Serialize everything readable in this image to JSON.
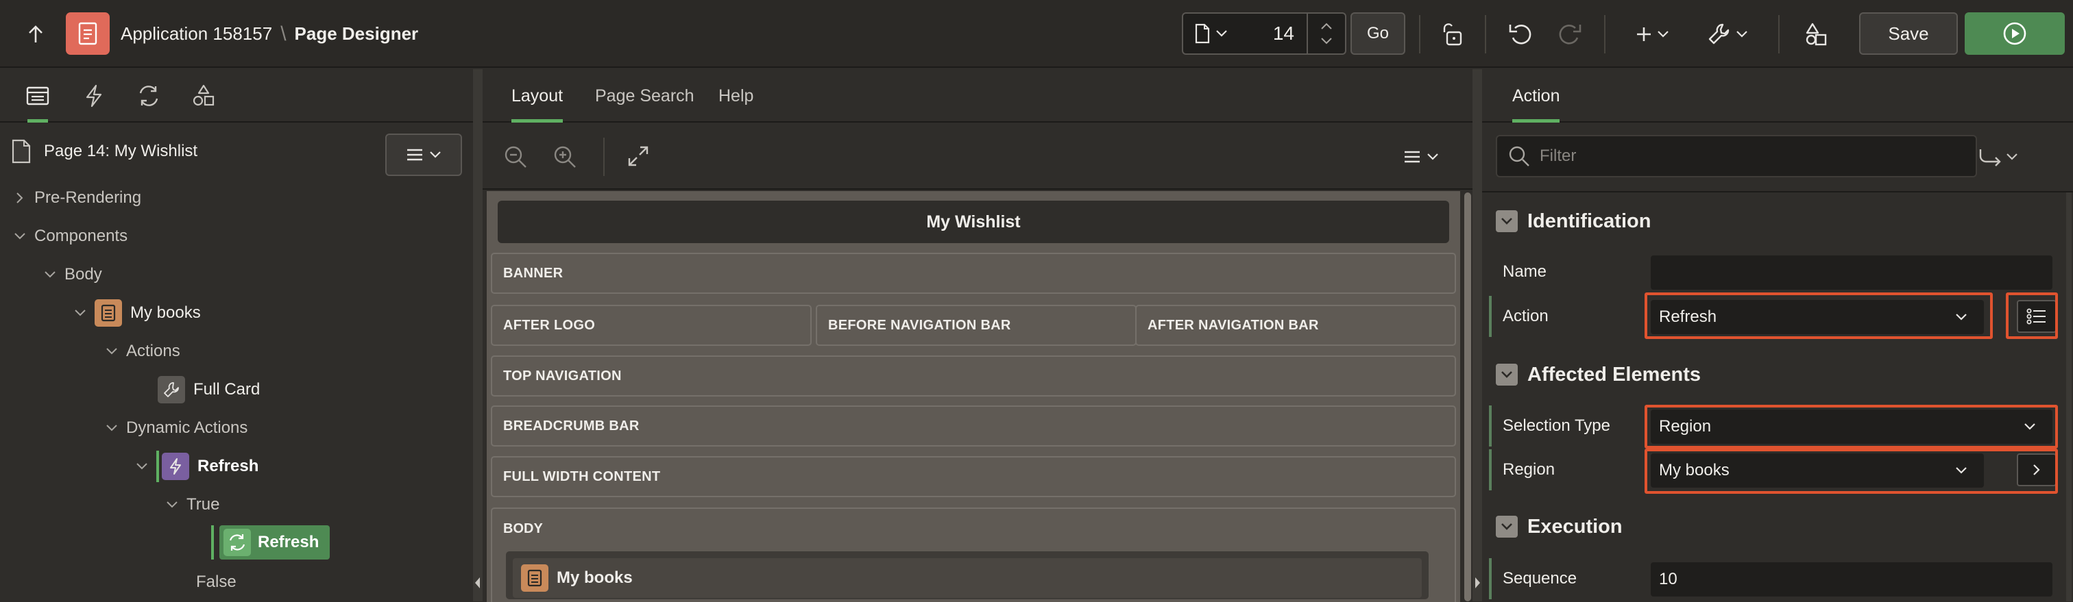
{
  "header": {
    "app_name": "Application 158157",
    "separator": "\\",
    "page_title": "Page Designer",
    "page_number": "14",
    "go_label": "Go",
    "save_label": "Save"
  },
  "left_panel": {
    "tabs": [
      "rendering-tab",
      "dynamic-actions-tab",
      "processing-tab",
      "shared-components-tab"
    ],
    "page_label": "Page 14: My Wishlist",
    "tree": {
      "pre_rendering": "Pre-Rendering",
      "components": "Components",
      "body": "Body",
      "my_books": "My books",
      "actions": "Actions",
      "full_card": "Full Card",
      "dynamic_actions": "Dynamic Actions",
      "refresh_da": "Refresh",
      "true_branch": "True",
      "refresh_action": "Refresh",
      "false_branch": "False"
    }
  },
  "center_panel": {
    "tabs": {
      "layout": "Layout",
      "page_search": "Page Search",
      "help": "Help"
    },
    "canvas": {
      "page_title": "My Wishlist",
      "banner": "BANNER",
      "after_logo": "AFTER LOGO",
      "before_navigation_bar": "BEFORE NAVIGATION BAR",
      "after_navigation_bar": "AFTER NAVIGATION BAR",
      "top_navigation": "TOP NAVIGATION",
      "breadcrumb_bar": "BREADCRUMB BAR",
      "full_width_content": "FULL WIDTH CONTENT",
      "body": "BODY",
      "region": "My books"
    }
  },
  "right_panel": {
    "tab": "Action",
    "filter_placeholder": "Filter",
    "identification": {
      "title": "Identification",
      "name_label": "Name",
      "name_value": "",
      "action_label": "Action",
      "action_value": "Refresh"
    },
    "affected_elements": {
      "title": "Affected Elements",
      "selection_type_label": "Selection Type",
      "selection_type_value": "Region",
      "region_label": "Region",
      "region_value": "My books"
    },
    "execution": {
      "title": "Execution",
      "sequence_label": "Sequence",
      "sequence_value": "10"
    }
  },
  "colors": {
    "accent_green": "#5fb062",
    "run_button": "#4e8a53",
    "app_icon": "#e06a5a",
    "highlight_red": "#e0532f",
    "region_icon": "#c98a5a",
    "dynamic_action_icon": "#7a5fa0"
  }
}
